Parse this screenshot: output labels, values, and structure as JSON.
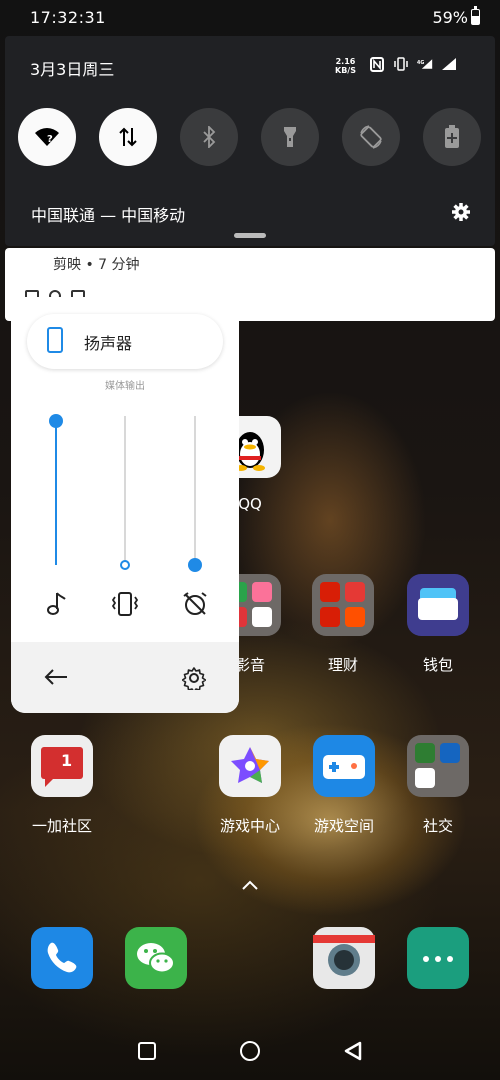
{
  "status_bar": {
    "time": "17:32:31",
    "battery": "59%"
  },
  "quick_settings": {
    "date": "3月3日周三",
    "net_speed_value": "2.16",
    "net_speed_unit": "KB/S",
    "carrier": "中国联通 — 中国移动",
    "tiles": [
      {
        "name": "wifi",
        "on": true
      },
      {
        "name": "mobile-data",
        "on": true
      },
      {
        "name": "bluetooth",
        "on": false
      },
      {
        "name": "flashlight",
        "on": false
      },
      {
        "name": "auto-rotate",
        "on": false
      },
      {
        "name": "battery-saver",
        "on": false
      }
    ]
  },
  "notification": {
    "app_time": "剪映 • 7 分钟"
  },
  "volume_panel": {
    "output_label": "扬声器",
    "media_output_caption": "媒体输出",
    "media_level": 1.0,
    "ring_level": 0.0,
    "alarm_level": 0.0
  },
  "home": {
    "apps": [
      {
        "label": "QQ"
      },
      {
        "label": "影音"
      },
      {
        "label": "理财"
      },
      {
        "label": "钱包"
      },
      {
        "label": "一加社区"
      },
      {
        "label": "游戏中心"
      },
      {
        "label": "游戏空间"
      },
      {
        "label": "社交"
      }
    ],
    "community_badge": "1"
  },
  "colors": {
    "accent": "#1f8ae6",
    "panel": "#202124"
  }
}
